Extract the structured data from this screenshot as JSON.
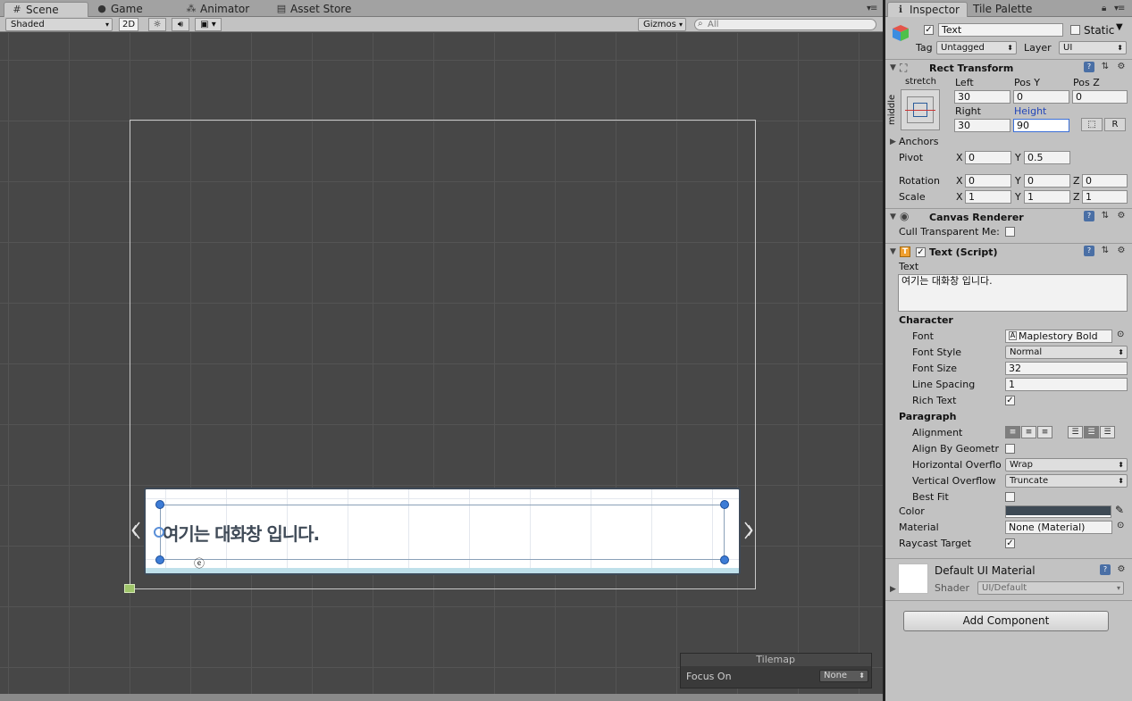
{
  "scene": {
    "tabs": [
      {
        "label": "Scene",
        "icon": "#"
      },
      {
        "label": "Game",
        "icon": "●"
      },
      {
        "label": "Animator",
        "icon": "⁂"
      },
      {
        "label": "Asset Store",
        "icon": "▤"
      }
    ],
    "toolbar": {
      "draw_mode": "Shaded",
      "mode_2d": "2D",
      "gizmos": "Gizmos",
      "search_placeholder": "All"
    },
    "dialog_text": "여기는 대화창 입니다.",
    "small_glyph": "ⓔ",
    "tilemap": {
      "title": "Tilemap",
      "focus_label": "Focus On",
      "focus_value": "None"
    }
  },
  "inspector": {
    "tabs": [
      {
        "label": "Inspector",
        "icon": "ℹ"
      },
      {
        "label": "Tile Palette"
      }
    ],
    "object": {
      "active": true,
      "name": "Text",
      "static_label": "Static",
      "static": false,
      "tag_label": "Tag",
      "tag_value": "Untagged",
      "layer_label": "Layer",
      "layer_value": "UI"
    },
    "rect_transform": {
      "title": "Rect Transform",
      "anchor_preset_top": "stretch",
      "anchor_preset_side": "middle",
      "labels": {
        "left": "Left",
        "pos_y": "Pos Y",
        "pos_z": "Pos Z",
        "right": "Right",
        "height": "Height"
      },
      "values": {
        "left": "30",
        "pos_y": "0",
        "pos_z": "0",
        "right": "30",
        "height": "90"
      },
      "blueprint_btn": "⬚",
      "raw_btn": "R",
      "anchors_label": "Anchors",
      "pivot_label": "Pivot",
      "pivot": {
        "x": "0",
        "y": "0.5"
      },
      "rotation_label": "Rotation",
      "rotation": {
        "x": "0",
        "y": "0",
        "z": "0"
      },
      "scale_label": "Scale",
      "scale": {
        "x": "1",
        "y": "1",
        "z": "1"
      },
      "axis": {
        "x": "X",
        "y": "Y",
        "z": "Z"
      }
    },
    "canvas_renderer": {
      "title": "Canvas Renderer",
      "cull_label": "Cull Transparent Me:",
      "cull": false
    },
    "text_script": {
      "title": "Text (Script)",
      "enabled": true,
      "text_label": "Text",
      "text_value": "여기는 대화창 입니다.",
      "character_label": "Character",
      "font_label": "Font",
      "font_value": "Maplestory Bold",
      "font_style_label": "Font Style",
      "font_style_value": "Normal",
      "font_size_label": "Font Size",
      "font_size_value": "32",
      "line_spacing_label": "Line Spacing",
      "line_spacing_value": "1",
      "rich_text_label": "Rich Text",
      "rich_text": true,
      "paragraph_label": "Paragraph",
      "alignment_label": "Alignment",
      "align_geometry_label": "Align By Geometr",
      "align_geometry": false,
      "h_overflow_label": "Horizontal Overflo",
      "h_overflow_value": "Wrap",
      "v_overflow_label": "Vertical Overflow",
      "v_overflow_value": "Truncate",
      "best_fit_label": "Best Fit",
      "best_fit": false,
      "color_label": "Color",
      "color_value": "#3e4a55",
      "material_label": "Material",
      "material_value": "None (Material)",
      "raycast_label": "Raycast Target",
      "raycast": true
    },
    "material": {
      "title": "Default UI Material",
      "shader_label": "Shader",
      "shader_value": "UI/Default"
    },
    "add_component": "Add Component"
  },
  "colors": {
    "scene_bg": "#474747",
    "panel_bg": "#c2c2c2",
    "handle_blue": "#3d7cd6",
    "dialog_border": "#3e4a58"
  }
}
